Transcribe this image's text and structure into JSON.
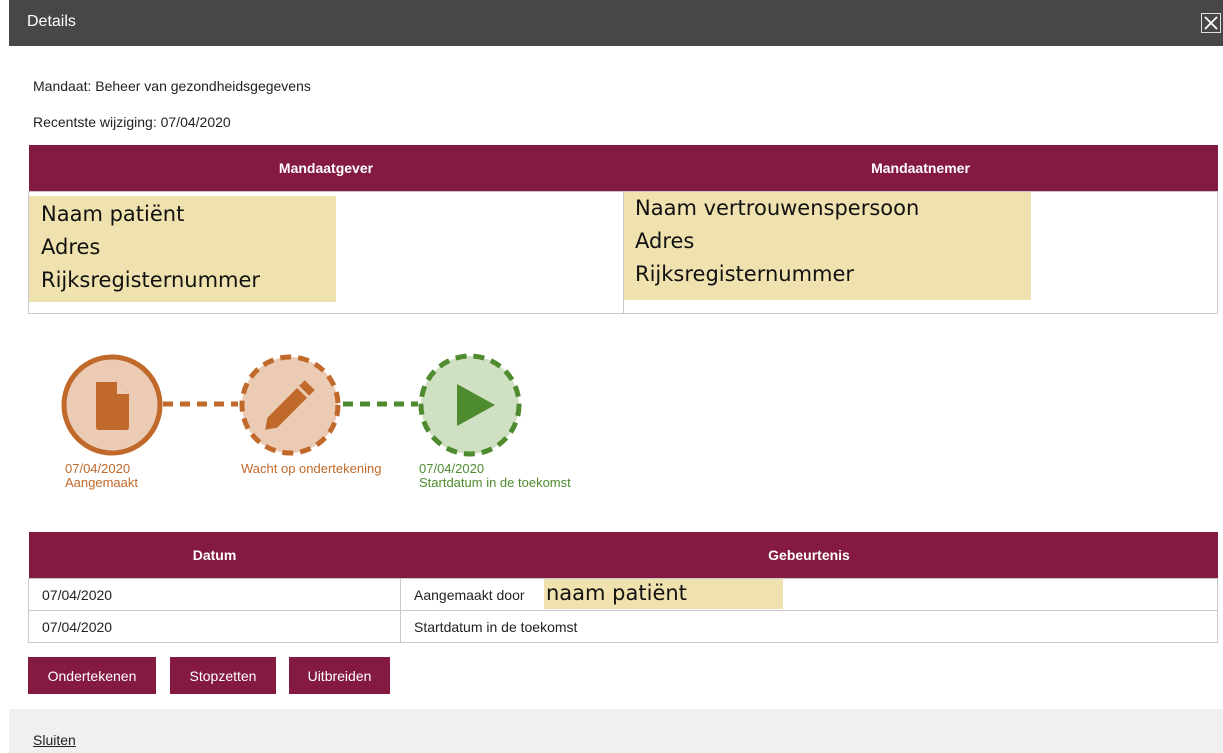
{
  "dialog": {
    "title": "Details",
    "close_icon": "close-icon",
    "mandate_line": "Mandaat: Beheer van gezondheidsgegevens",
    "last_change_line": "Recentste wijziging: 07/04/2020"
  },
  "parties": {
    "headers": [
      "Mandaatgever",
      "Mandaatnemer"
    ],
    "giver": [
      "Naam patiënt",
      "Adres",
      "Rijksregisternummer"
    ],
    "receiver": [
      "Naam vertrouwenspersoon",
      "Adres",
      "Rijksregisternummer"
    ],
    "highlight_color": "#f0e2ae"
  },
  "timeline": {
    "steps": [
      {
        "date": "07/04/2020",
        "label": "Aangemaakt",
        "icon": "document-icon",
        "color": "#c0692a"
      },
      {
        "date": "",
        "label": "Wacht op ondertekening",
        "icon": "pencil-icon",
        "color": "#c0692a"
      },
      {
        "date": "07/04/2020",
        "label": "Startdatum in de toekomst",
        "icon": "play-icon",
        "color": "#4e8a2e"
      }
    ]
  },
  "events": {
    "headers": [
      "Datum",
      "Gebeurtenis"
    ],
    "rows": [
      {
        "date": "07/04/2020",
        "event": "Aangemaakt door",
        "highlight": "naam patiënt"
      },
      {
        "date": "07/04/2020",
        "event": "Startdatum in de toekomst",
        "highlight": ""
      }
    ]
  },
  "actions": {
    "sign": "Ondertekenen",
    "stop": "Stopzetten",
    "extend": "Uitbreiden",
    "close_link": "Sluiten"
  },
  "colors": {
    "accent": "#841a42",
    "titlebar": "#474747",
    "orange": "#c0692a",
    "green": "#4e8a2e"
  }
}
